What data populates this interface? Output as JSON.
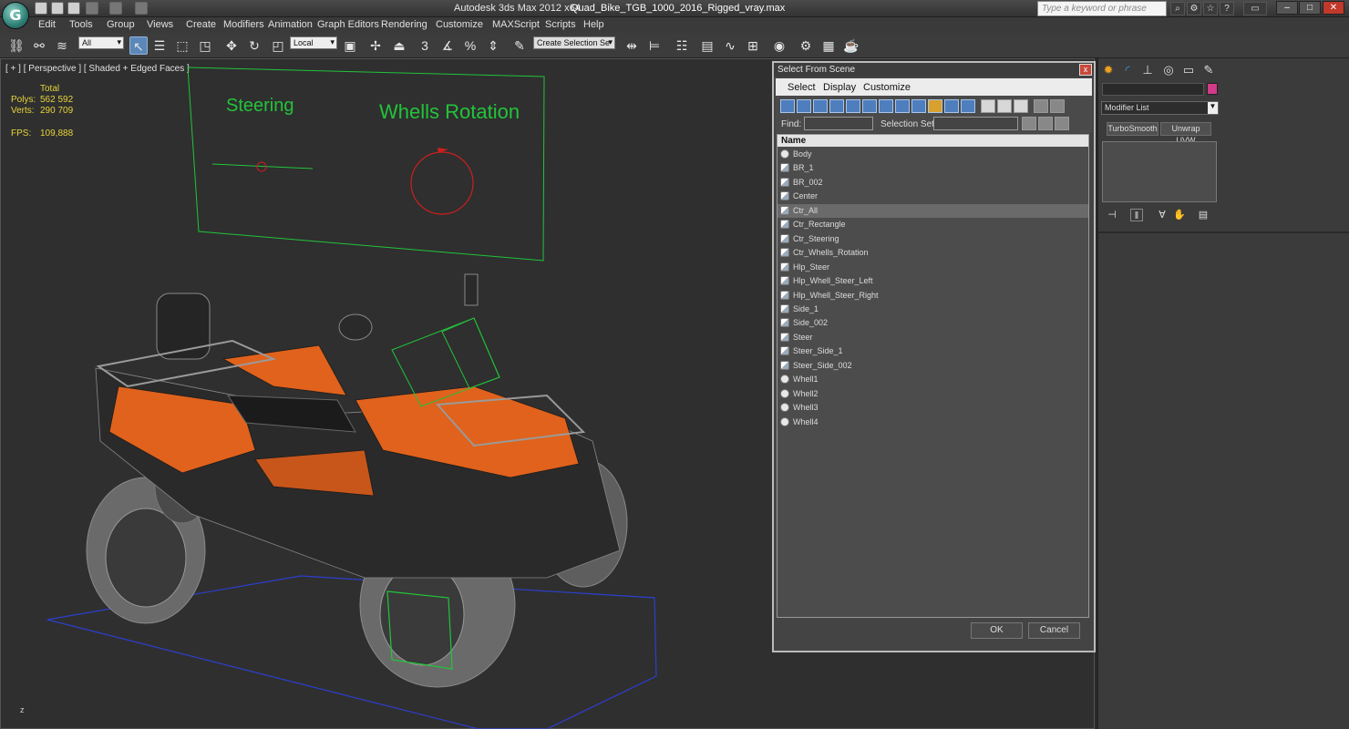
{
  "window": {
    "app_title": "Autodesk 3ds Max  2012 x64",
    "file_title": "Quad_Bike_TGB_1000_2016_Rigged_vray.max",
    "search_placeholder": "Type a keyword or phrase",
    "logo_text": "G"
  },
  "menu": [
    "Edit",
    "Tools",
    "Group",
    "Views",
    "Create",
    "Modifiers",
    "Animation",
    "Graph Editors",
    "Rendering",
    "Customize",
    "MAXScript",
    "Scripts",
    "Help"
  ],
  "toolbar": {
    "selection_filter": "All",
    "reference_coord": "Local",
    "snap_label": "3",
    "selection_set": "Create Selection Se"
  },
  "viewport": {
    "label": "[ + ] [ Perspective ] [ Shaded + Edged Faces ]",
    "stats": {
      "total_label": "Total",
      "polys_label": "Polys:",
      "polys_value": "562 592",
      "verts_label": "Verts:",
      "verts_value": "290 709",
      "fps_label": "FPS:",
      "fps_value": "109,888"
    },
    "rig_labels": {
      "steering": "Steering",
      "wheels_rotation": "Whells Rotation"
    },
    "axis_label": "z"
  },
  "colors": {
    "accent_orange": "#e0621c",
    "rig_green": "#22c43a",
    "rig_red": "#cc1f1f",
    "selection_blue": "#2c3fcf"
  },
  "dialog": {
    "title": "Select From Scene",
    "close": "x",
    "menu": [
      "Select",
      "Display",
      "Customize"
    ],
    "find_label": "Find:",
    "selection_set_label": "Selection Set:",
    "column_header": "Name",
    "selected_item": "Ctr_All",
    "items": [
      {
        "name": "Body",
        "icon": "sphere"
      },
      {
        "name": "BR_1",
        "icon": "bone"
      },
      {
        "name": "BR_002",
        "icon": "bone"
      },
      {
        "name": "Center",
        "icon": "bone"
      },
      {
        "name": "Ctr_All",
        "icon": "shape"
      },
      {
        "name": "Ctr_Rectangle",
        "icon": "shape"
      },
      {
        "name": "Ctr_Steering",
        "icon": "shape"
      },
      {
        "name": "Ctr_Whells_Rotation",
        "icon": "shape"
      },
      {
        "name": "Hlp_Steer",
        "icon": "helper"
      },
      {
        "name": "Hlp_Whell_Steer_Left",
        "icon": "helper"
      },
      {
        "name": "Hlp_Whell_Steer_Right",
        "icon": "helper"
      },
      {
        "name": "Side_1",
        "icon": "bone"
      },
      {
        "name": "Side_002",
        "icon": "bone"
      },
      {
        "name": "Steer",
        "icon": "bone"
      },
      {
        "name": "Steer_Side_1",
        "icon": "bone"
      },
      {
        "name": "Steer_Side_002",
        "icon": "bone"
      },
      {
        "name": "Whell1",
        "icon": "sphere"
      },
      {
        "name": "Whell2",
        "icon": "sphere"
      },
      {
        "name": "Whell3",
        "icon": "sphere"
      },
      {
        "name": "Whell4",
        "icon": "sphere"
      }
    ],
    "ok": "OK",
    "cancel": "Cancel"
  },
  "command_panel": {
    "modifier_list": "Modifier List",
    "modifiers": [
      "TurboSmooth",
      "Unwrap UVW"
    ],
    "object_color": "#d23a8a"
  }
}
